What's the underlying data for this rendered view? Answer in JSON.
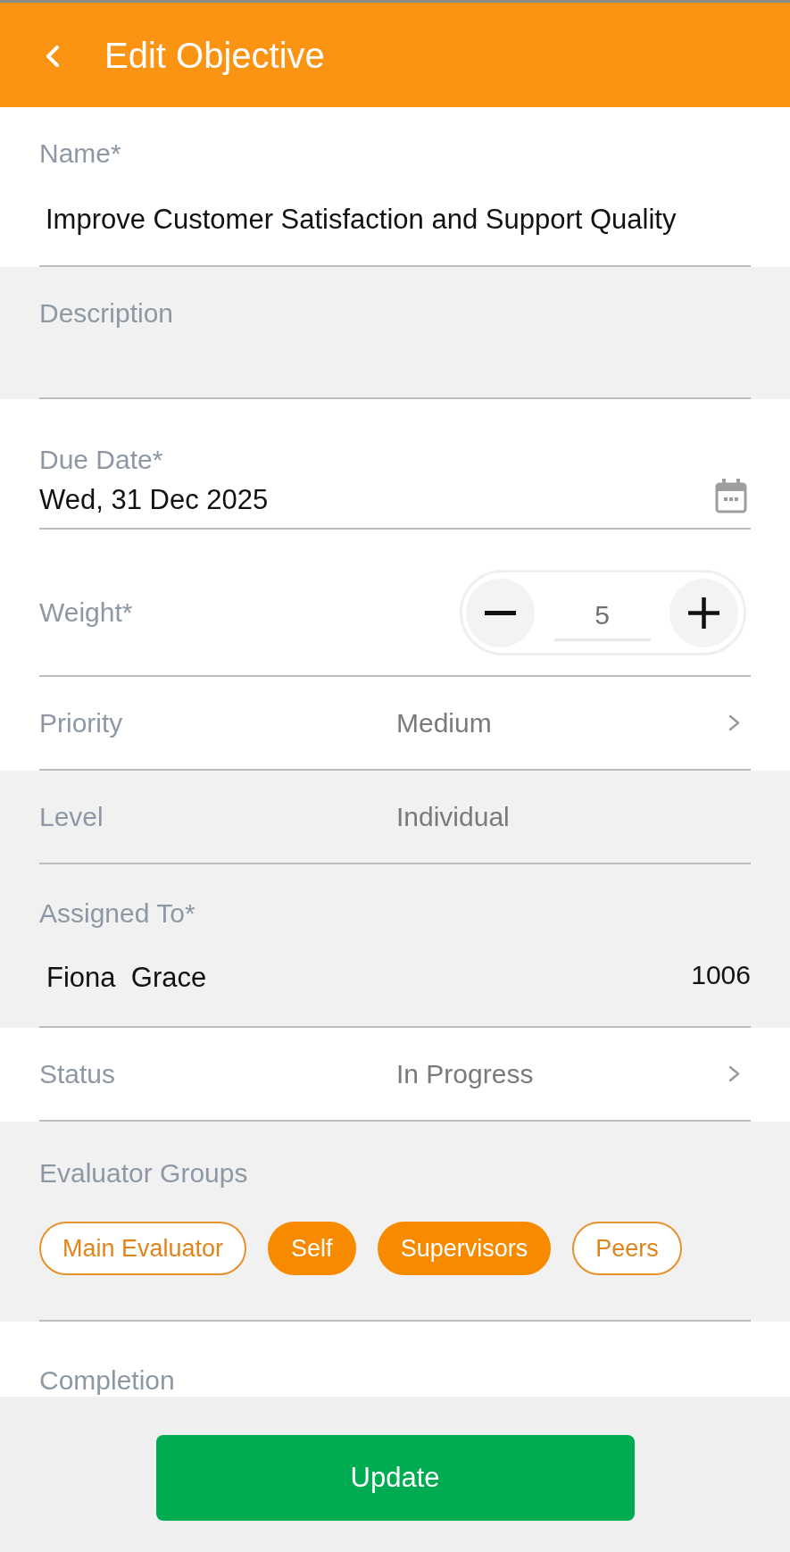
{
  "header": {
    "title": "Edit Objective"
  },
  "fields": [
    {
      "kind": "text",
      "label": "Name*",
      "value": "Improve Customer Satisfaction and Support Quality",
      "disabled": false
    },
    {
      "kind": "text",
      "label": "Description",
      "disabled": true
    },
    {
      "kind": "date",
      "label": "Due Date*",
      "value": "Wed, 31 Dec 2025",
      "disabled": false
    },
    {
      "kind": "stepper",
      "label": "Weight*",
      "value": "5",
      "disabled": false
    },
    {
      "kind": "select",
      "label": "Priority",
      "value": "Medium",
      "disabled": false
    },
    {
      "kind": "select",
      "label": "Level",
      "value": "Individual",
      "disabled": true
    },
    {
      "kind": "person",
      "label": "Assigned To*",
      "value": "Fiona  Grace",
      "code": "1006",
      "disabled": true
    },
    {
      "kind": "select",
      "label": "Status",
      "value": "In Progress",
      "disabled": false
    },
    {
      "kind": "chips",
      "label": "Evaluator Groups",
      "disabled": true,
      "chips": [
        {
          "label": "Main Evaluator",
          "selected": false
        },
        {
          "label": "Self",
          "selected": true
        },
        {
          "label": "Supervisors",
          "selected": true
        },
        {
          "label": "Peers",
          "selected": false
        }
      ]
    },
    {
      "kind": "heading",
      "label": "Completion",
      "disabled": false
    }
  ],
  "update_button": {
    "label": "Update"
  }
}
